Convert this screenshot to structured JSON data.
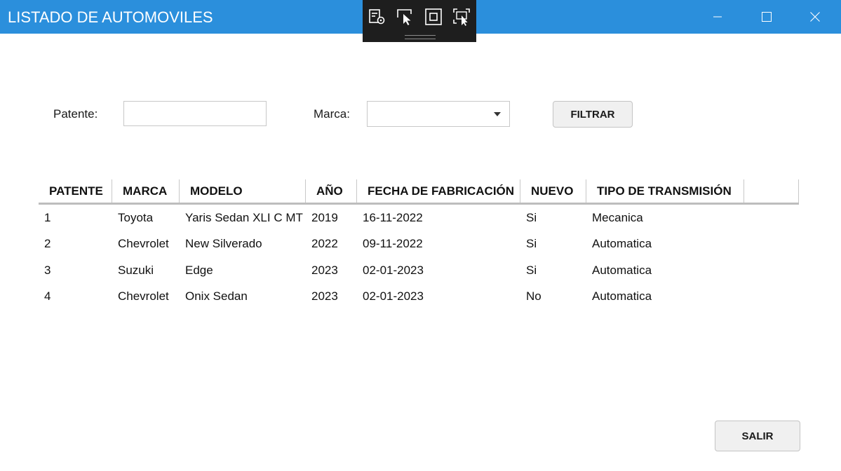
{
  "window": {
    "title": "LISTADO DE AUTOMOVILES",
    "accent_color": "#2b8fdc",
    "controls": [
      "minimize-icon",
      "maximize-icon",
      "close-icon"
    ]
  },
  "debug_toolbar": {
    "icons": [
      "live-visual-tree-icon",
      "select-element-icon",
      "display-layout-adorners-icon",
      "track-focused-element-icon"
    ]
  },
  "filters": {
    "patente_label": "Patente:",
    "patente_value": "",
    "marca_label": "Marca:",
    "marca_value": "",
    "filter_button": "FILTRAR"
  },
  "grid": {
    "columns": [
      "PATENTE",
      "MARCA",
      "MODELO",
      "AÑO",
      "FECHA DE FABRICACIÓN",
      "NUEVO",
      "TIPO DE TRANSMISIÓN"
    ],
    "rows": [
      [
        "1",
        "Toyota",
        "Yaris Sedan XLI C MT",
        "2019",
        "16-11-2022",
        "Si",
        "Mecanica"
      ],
      [
        "2",
        "Chevrolet",
        "New Silverado",
        "2022",
        "09-11-2022",
        "Si",
        "Automatica"
      ],
      [
        "3",
        "Suzuki",
        "Edge",
        "2023",
        "02-01-2023",
        "Si",
        "Automatica"
      ],
      [
        "4",
        "Chevrolet",
        "Onix Sedan",
        "2023",
        "02-01-2023",
        "No",
        "Automatica"
      ]
    ]
  },
  "footer": {
    "exit_button": "SALIR"
  }
}
